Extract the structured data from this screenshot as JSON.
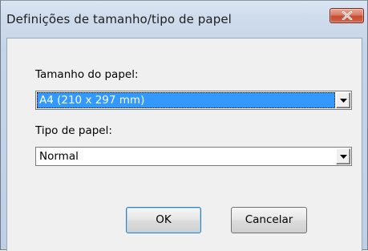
{
  "window": {
    "title": "Definições de tamanho/tipo de papel"
  },
  "paper_size": {
    "label": "Tamanho do papel:",
    "selected": "A4 (210 x 297 mm)"
  },
  "paper_type": {
    "label": "Tipo de papel:",
    "selected": "Normal"
  },
  "buttons": {
    "ok": "OK",
    "cancel": "Cancelar"
  },
  "icons": {
    "close": "close-icon",
    "dropdown": "chevron-down-icon"
  },
  "colors": {
    "selection": "#3399ff",
    "close_button": "#c74a30",
    "default_button_border": "#3c7fb1"
  }
}
